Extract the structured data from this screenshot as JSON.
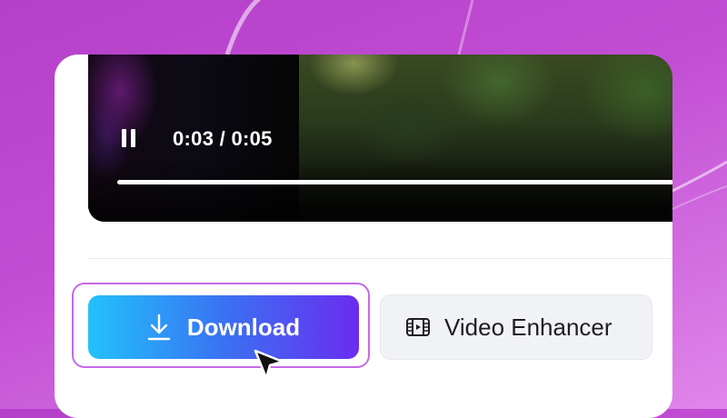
{
  "player": {
    "time_display": "0:03 / 0:05",
    "progress": 1.0
  },
  "actions": {
    "download_label": "Download",
    "enhancer_label": "Video Enhancer"
  },
  "icons": {
    "pause": "pause-icon",
    "download": "download-icon",
    "enhancer": "film-strip-icon",
    "cursor": "mouse-pointer-icon"
  },
  "colors": {
    "background": "#c24ed4",
    "download_gradient_start": "#22c2fb",
    "download_gradient_end": "#6a2cf0",
    "highlight_outline": "#c46ae8",
    "secondary_button": "#f1f2f6"
  }
}
